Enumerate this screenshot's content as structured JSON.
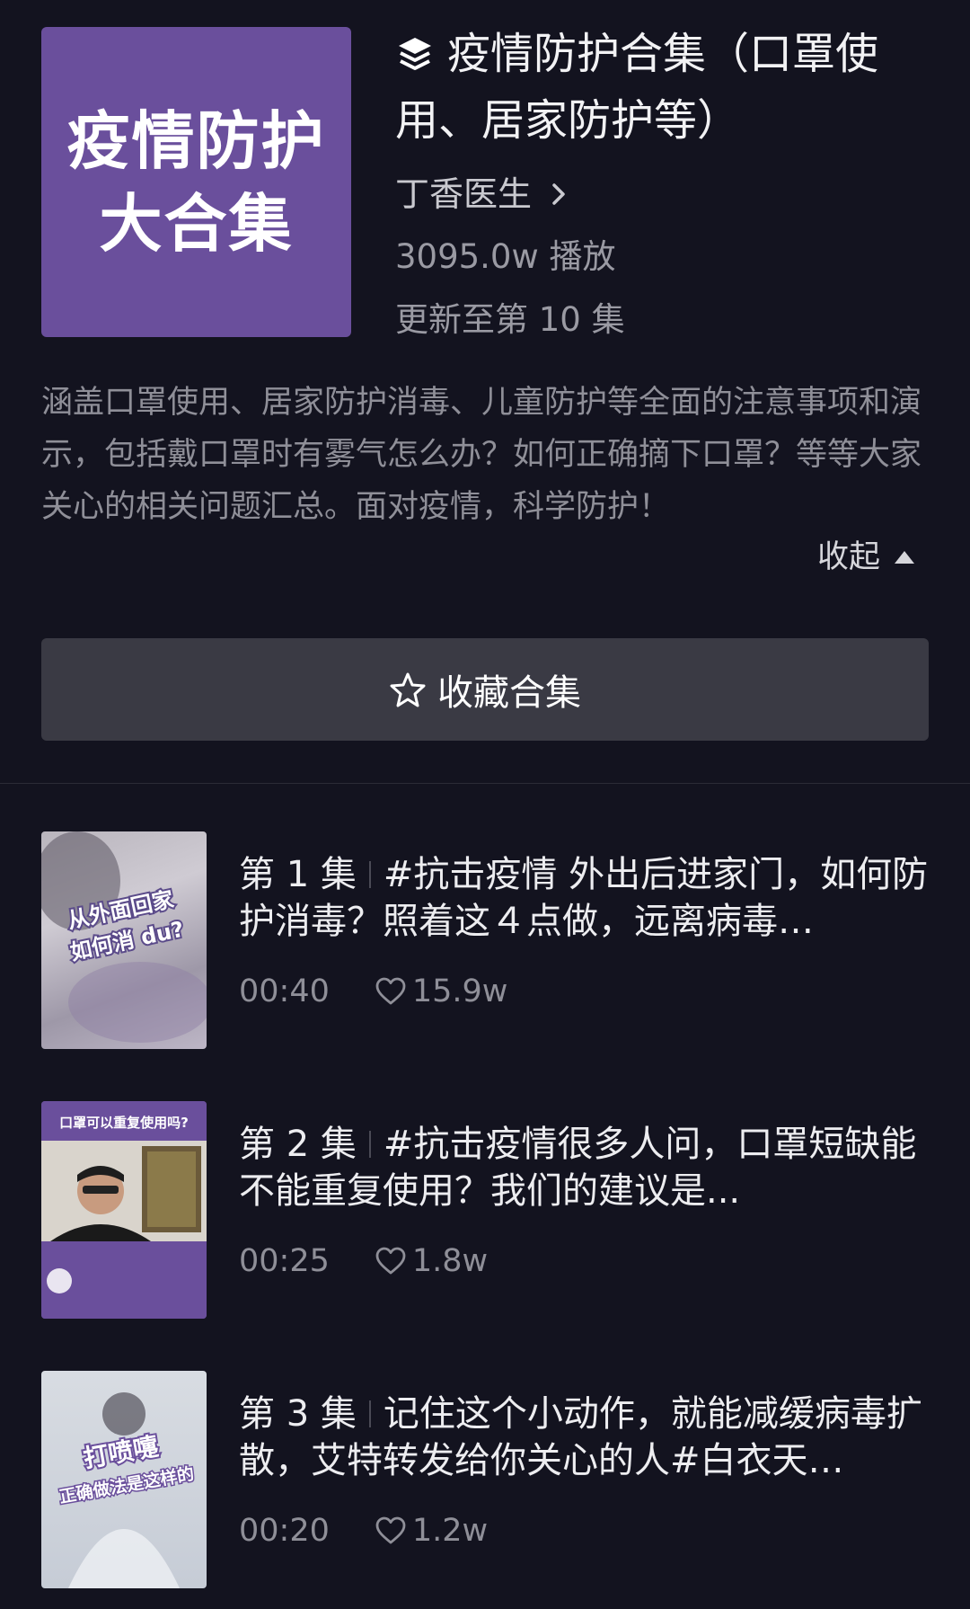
{
  "collection": {
    "cover_lines": [
      "疫情防护",
      "大合集"
    ],
    "title": "疫情防护合集（口罩使用、居家防护等）",
    "author": "丁香医生",
    "plays": "3095.0w 播放",
    "update_status": "更新至第 10 集",
    "description": "涵盖口罩使用、居家防护消毒、儿童防护等全面的注意事项和演示，包括戴口罩时有雾气怎么办？如何正确摘下口罩？等等大家关心的相关问题汇总。面对疫情，科学防护！",
    "collapse_label": "收起",
    "favorite_label": "收藏合集"
  },
  "episodes": [
    {
      "number": "第 1 集",
      "title": "#抗击疫情 外出后进家门，如何防护消毒？照着这４点做，远离病毒…",
      "duration": "00:40",
      "likes": "15.9w",
      "thumb_text": [
        "从外面回家",
        "如何消 du?"
      ]
    },
    {
      "number": "第 2 集",
      "title": "#抗击疫情很多人问，口罩短缺能不能重复使用？我们的建议是...",
      "duration": "00:25",
      "likes": "1.8w",
      "thumb_text": [
        "口罩可以重复使用吗?"
      ]
    },
    {
      "number": "第 3 集",
      "title": "记住这个小动作，就能减缓病毒扩散，艾特转发给你关心的人#白衣天…",
      "duration": "00:20",
      "likes": "1.2w",
      "thumb_text": [
        "打喷嚏",
        "正确做法是这样的"
      ]
    }
  ],
  "colors": {
    "background": "#13131f",
    "cover": "#6a4f9c",
    "button": "#3a3a44"
  },
  "icons": [
    "collection-stack-icon",
    "chevron-right-icon",
    "triangle-up-icon",
    "star-icon",
    "heart-icon"
  ]
}
